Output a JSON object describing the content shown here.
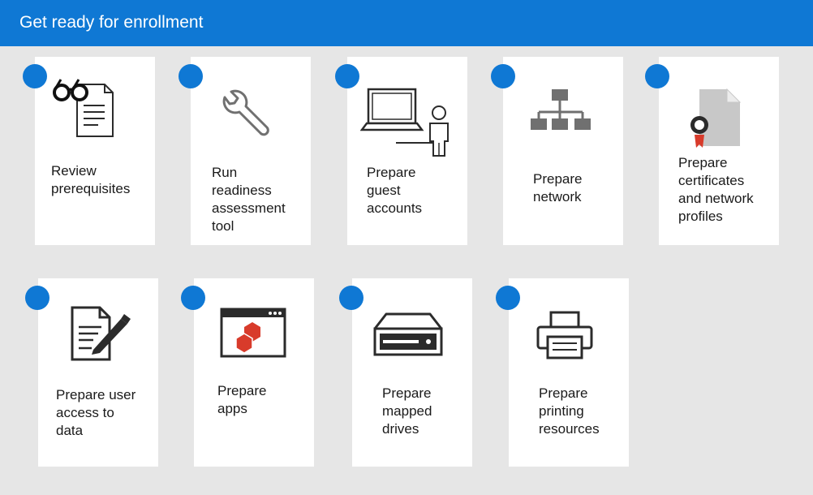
{
  "header": {
    "title": "Get ready for enrollment"
  },
  "colors": {
    "accent": "#0f78d4",
    "icon_gray": "#707070",
    "icon_dark": "#2b2b2b",
    "app_red": "#d83b2b"
  },
  "steps": [
    {
      "icon": "glasses-document-icon",
      "label": "Review\nprerequisites"
    },
    {
      "icon": "wrench-icon",
      "label": "Run\nreadiness\nassessment\ntool"
    },
    {
      "icon": "laptop-user-icon",
      "label": "Prepare\nguest\naccounts"
    },
    {
      "icon": "network-hierarchy-icon",
      "label": "Prepare\nnetwork"
    },
    {
      "icon": "certificate-icon",
      "label": "Prepare\ncertificates\nand network\nprofiles"
    },
    {
      "icon": "signed-document-icon",
      "label": "Prepare user\naccess to\ndata"
    },
    {
      "icon": "app-window-icon",
      "label": "Prepare\napps"
    },
    {
      "icon": "drive-icon",
      "label": "Prepare\nmapped\ndrives"
    },
    {
      "icon": "printer-icon",
      "label": "Prepare\nprinting\nresources"
    }
  ]
}
